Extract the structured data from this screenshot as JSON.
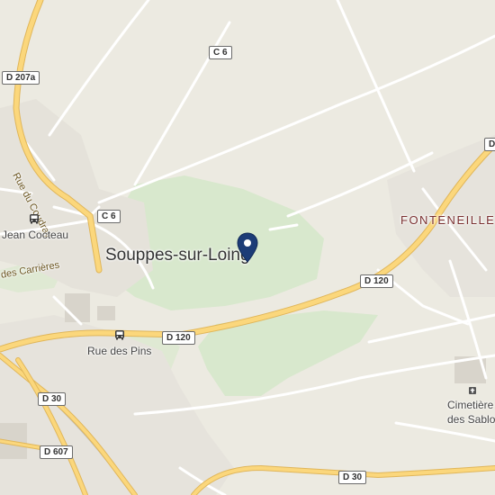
{
  "map": {
    "town_label": "Souppes-sur-Loing",
    "village_label": "FONTENEILLES",
    "poi": {
      "bus_stop_1": "Jean Cocteau",
      "bus_stop_2": "Rue des Pins",
      "cemetery_line1": "Cimetière",
      "cemetery_line2": "des Sablon"
    },
    "streets": {
      "rue_du_coudray": "Rue du Coudray",
      "des_carrieres": "des Carrières"
    },
    "road_shields": {
      "d207a": "D 207a",
      "c6_top": "C 6",
      "c6_left": "C 6",
      "d120_right": "D 120",
      "d120_mid": "D 120",
      "d30_left": "D 30",
      "d607": "D 607",
      "d30_bottom": "D 30",
      "d_edge": "D"
    },
    "icons": {
      "marker": "location-pin-icon",
      "bus": "bus-stop-icon",
      "cemetery": "cemetery-icon"
    },
    "colors": {
      "land": "#eceae1",
      "green": "#d7e8cc",
      "major_road": "#fbd77c",
      "minor_road": "#ffffff",
      "marker": "#1c3c77",
      "village_text": "#7a3030"
    }
  }
}
